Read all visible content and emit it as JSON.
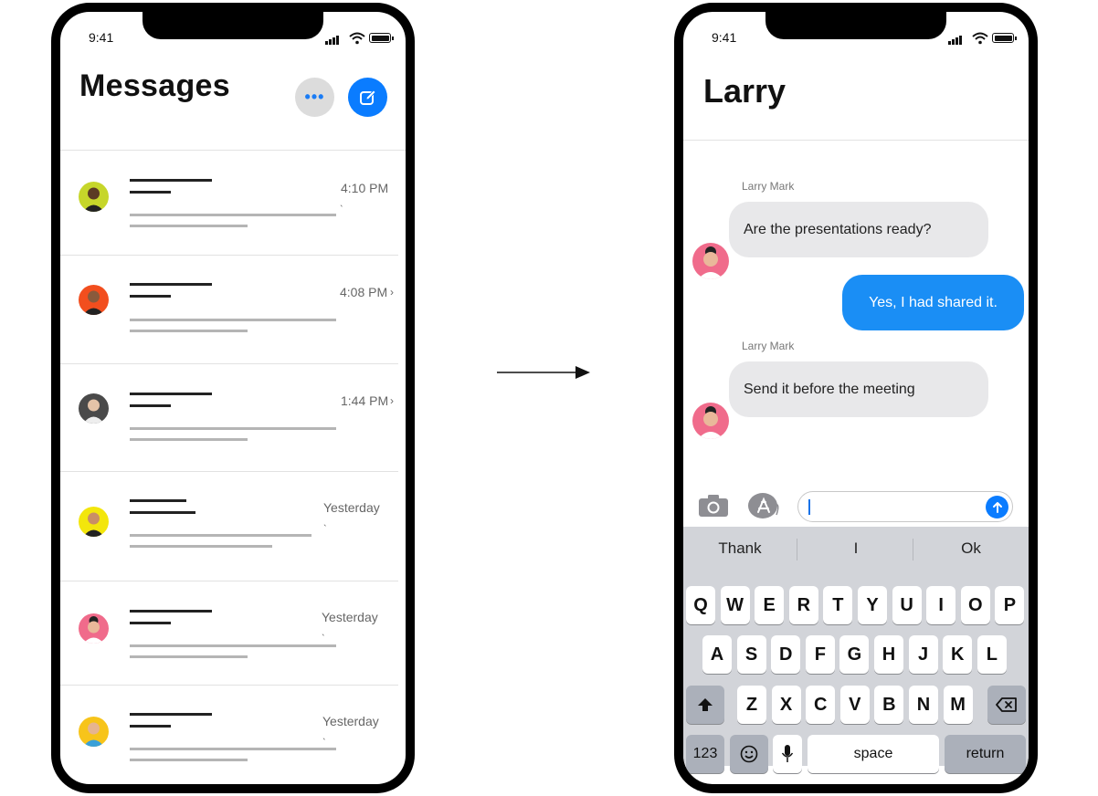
{
  "status": {
    "time": "9:41"
  },
  "inbox": {
    "title": "Messages",
    "more_icon": "ellipsis-icon",
    "compose_icon": "compose-icon",
    "conversations": [
      {
        "time": "4:10 PM",
        "avatar_color": "#c6d62a",
        "skin": "#5b3a24"
      },
      {
        "time": "4:08 PM",
        "avatar_color": "#f24e1e",
        "skin": "#8a5a3c"
      },
      {
        "time": "1:44 PM",
        "avatar_color": "#4a4a4a",
        "skin": "#e4c3a8"
      },
      {
        "time": "Yesterday",
        "avatar_color": "#f3e60c",
        "skin": "#c98e66"
      },
      {
        "time": "Yesterday",
        "avatar_color": "#f06b8b",
        "skin": "#e9b89a"
      },
      {
        "time": "Yesterday",
        "avatar_color": "#f7c41a",
        "skin": "#e6b48f"
      }
    ]
  },
  "chat": {
    "title": "Larry",
    "messages": [
      {
        "sender": "Larry Mark",
        "text": "Are the presentations ready?",
        "direction": "incoming"
      },
      {
        "sender": "",
        "text": "Yes, I had shared it.",
        "direction": "outgoing"
      },
      {
        "sender": "Larry Mark",
        "text": "Send it before the meeting",
        "direction": "incoming"
      }
    ],
    "input_value": "",
    "accent_color": "#0a7cff"
  },
  "keyboard": {
    "suggestions": [
      "Thank",
      "I",
      "Ok"
    ],
    "row1": [
      "Q",
      "W",
      "E",
      "R",
      "T",
      "Y",
      "U",
      "I",
      "O",
      "P"
    ],
    "row2": [
      "A",
      "S",
      "D",
      "F",
      "G",
      "H",
      "J",
      "K",
      "L"
    ],
    "row3": [
      "Z",
      "X",
      "C",
      "V",
      "B",
      "N",
      "M"
    ],
    "numbers_key": "123",
    "space_key": "space",
    "return_key": "return"
  }
}
